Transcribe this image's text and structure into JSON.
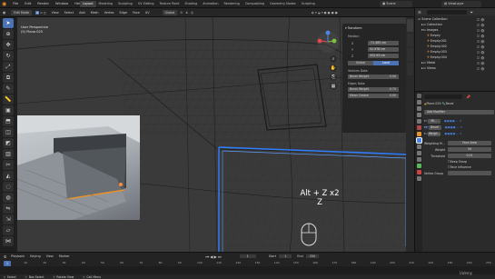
{
  "menu": {
    "items": [
      "File",
      "Edit",
      "Render",
      "Window",
      "Help"
    ]
  },
  "workspaces": [
    "Layout",
    "Modeling",
    "Sculpting",
    "UV Editing",
    "Texture Paint",
    "Shading",
    "Animation",
    "Rendering",
    "Compositing",
    "Geometry Nodes",
    "Scripting"
  ],
  "scene_label": "Scene",
  "viewlayer_label": "ViewLayer",
  "header": {
    "mode": "Edit Mode",
    "items": [
      "View",
      "Select",
      "Add",
      "Mesh",
      "Vertex",
      "Edge",
      "Face",
      "UV"
    ],
    "orientation": "Global",
    "options": "Options"
  },
  "viewport": {
    "perspective": "User Perspective",
    "object": "(5) Plane.025",
    "shortcut": "Alt + Z x2",
    "key": "Z"
  },
  "npanel": {
    "title": "Transform",
    "median": "Median:",
    "x_label": "X",
    "x_val": "-71.485 cm",
    "y_label": "Y",
    "y_val": "52.978 cm",
    "z_label": "Z",
    "z_val": "353.93 cm",
    "global": "Global",
    "local": "Local",
    "vertices_data": "Vertices Data:",
    "bevel_weight": "Bevel Weight",
    "bevel_weight_val": "0.00",
    "edges_data": "Edges Data:",
    "bevel_weight2": "Bevel Weight",
    "bevel_weight2_val": "0.75",
    "mean_crease": "Mean Crease",
    "mean_crease_val": "0.00"
  },
  "outliner": {
    "items": [
      "Scene Collection",
      "Collection",
      "Images",
      "Empty",
      "Empty.001",
      "Empty.002",
      "Empty.003",
      "Empty.004",
      "Metal",
      "Views"
    ]
  },
  "properties": {
    "object": "Plane.025",
    "modifier_name": "Bevel",
    "add_modifier": "Add Modifier",
    "modifiers": [
      "Mi...",
      "Bevel",
      "Weigh..."
    ],
    "weighting_mode_label": "Weighting M...",
    "weighting_mode_val": "Face Area",
    "weight_label": "Weight",
    "weight_val": "50",
    "threshold_label": "Threshold",
    "threshold_val": "0.01",
    "keep_sharp": "Keep Sharp",
    "face_influence": "Face Influence",
    "vertex_group": "Vertex Group"
  },
  "timeline": {
    "items": [
      "Playback",
      "Keying",
      "View",
      "Marker"
    ],
    "frame": "1",
    "start_label": "Start",
    "start": "1",
    "end_label": "End",
    "end": "250",
    "ticks": [
      "0",
      "10",
      "20",
      "30",
      "40",
      "50",
      "60",
      "70",
      "80",
      "90",
      "100",
      "110",
      "120",
      "130",
      "140",
      "150",
      "160",
      "170",
      "180",
      "190",
      "200",
      "210",
      "220",
      "230",
      "240",
      "250"
    ],
    "status": [
      "Select",
      "Box Select",
      "Rotate View",
      "Call Menu"
    ]
  },
  "watermark": "Udemy",
  "colors": {
    "active_blue": "#4a72b5",
    "selected_edge": "#2f7fff",
    "orange": "#e6922d",
    "axis_x": "#e5474e",
    "axis_y": "#7fc23d",
    "axis_z": "#4a86e8"
  }
}
